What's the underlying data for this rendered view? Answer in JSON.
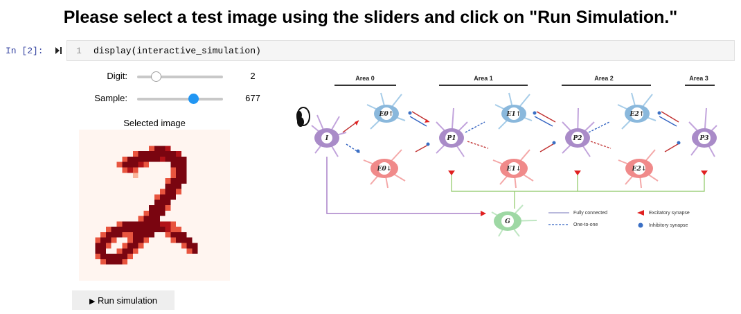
{
  "heading": "Please select a test image using the sliders and click on \"Run Simulation.\"",
  "cell": {
    "prompt": "In [2]:",
    "line_number": "1",
    "code": "display(interactive_simulation)"
  },
  "sliders": [
    {
      "label": "Digit:",
      "value": "2",
      "fraction": 0.22
    },
    {
      "label": "Sample:",
      "value": "677",
      "fraction": 0.66
    }
  ],
  "image_panel": {
    "title": "Selected image"
  },
  "run_button": {
    "label": "Run simulation",
    "icon": "play-icon"
  },
  "diagram": {
    "areas": [
      "Area 0",
      "Area 1",
      "Area 2",
      "Area 3"
    ],
    "neurons": {
      "input": "I",
      "pyramidal": [
        "P1",
        "P2",
        "P3"
      ],
      "e_up": [
        "E0↑",
        "E1↑",
        "E2↑"
      ],
      "e_down": [
        "E0↓",
        "E1↓",
        "E2↓"
      ],
      "global": "G"
    },
    "legend": {
      "fully_connected": "Fully connected",
      "one_to_one": "One-to-one",
      "excitatory": "Excitatory synapse",
      "inhibitory": "Inhibitory synapse"
    }
  },
  "colors": {
    "prompt": "#303f9f",
    "slider_handle_digit": "#ffffff",
    "slider_handle_sample": "#2196f3",
    "digit_dark": "#67000d",
    "digit_background": "#fff5f0",
    "pyramidal": "#a98bc8",
    "e_up": "#8ab8dc",
    "e_down": "#f08a8a",
    "global": "#9ed8a4"
  }
}
